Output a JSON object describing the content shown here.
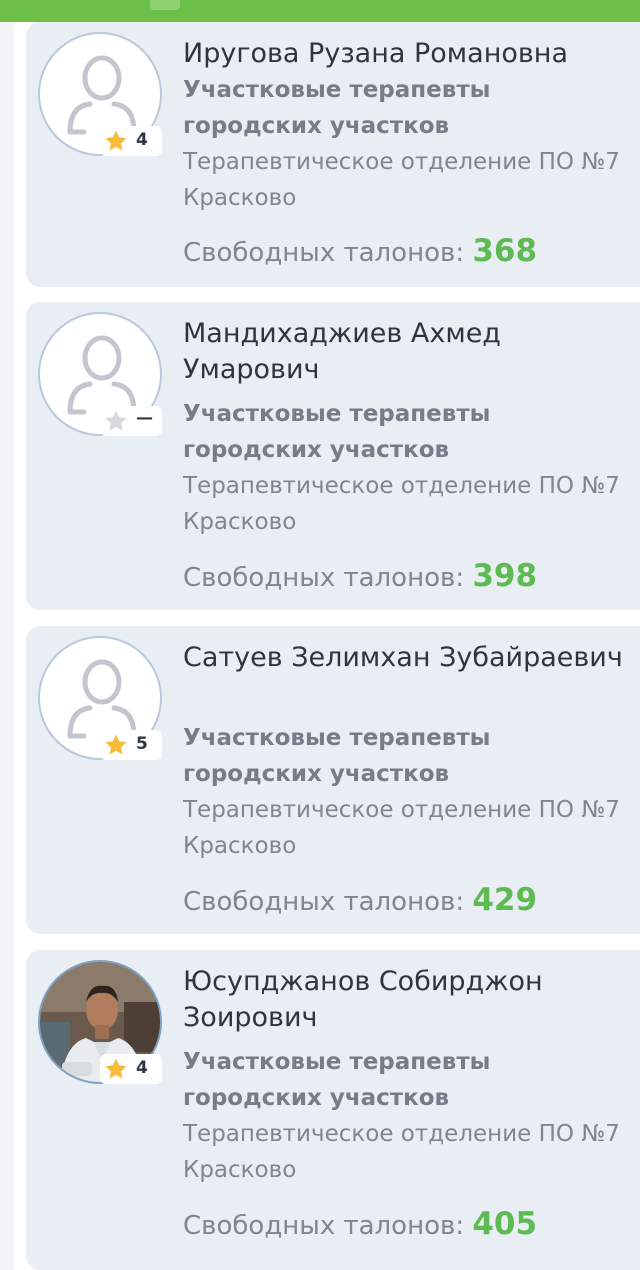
{
  "doctors": [
    {
      "name": "Иругова Рузана Романовна",
      "specialty": "Участковые терапевты городских участков",
      "department": "Терапевтическое отделение ПО №7 Красково",
      "tickets_label": "Свободных талонов: ",
      "tickets_count": "368",
      "rating": "4",
      "star_color": "#f5bd3a",
      "avatar": "placeholder-person-icon"
    },
    {
      "name": "Мандихаджиев Ахмед Умарович",
      "specialty": "Участковые терапевты городских участков",
      "department": "Терапевтическое отделение ПО №7 Красково",
      "tickets_label": "Свободных талонов: ",
      "tickets_count": "398",
      "rating": "—",
      "star_color": "#d5d9df",
      "avatar": "placeholder-person-icon"
    },
    {
      "name": "Сатуев Зелимхан Зубайраевич",
      "specialty": "Участковые терапевты городских участков",
      "department": "Терапевтическое отделение ПО №7 Красково",
      "tickets_label": "Свободных талонов: ",
      "tickets_count": "429",
      "rating": "5",
      "star_color": "#f5bd3a",
      "avatar": "placeholder-person-icon"
    },
    {
      "name": "Юсупджанов Собирджон Зоирович",
      "specialty": "Участковые терапевты городских участков",
      "department": "Терапевтическое отделение ПО №7 Красково",
      "tickets_label": "Свободных талонов: ",
      "tickets_count": "405",
      "rating": "4",
      "star_color": "#f5bd3a",
      "avatar": "doctor-photo"
    }
  ],
  "colors": {
    "top_bar": "#6cc04a",
    "card_background": "#e9eef5",
    "tickets_count": "#5dbb52"
  }
}
